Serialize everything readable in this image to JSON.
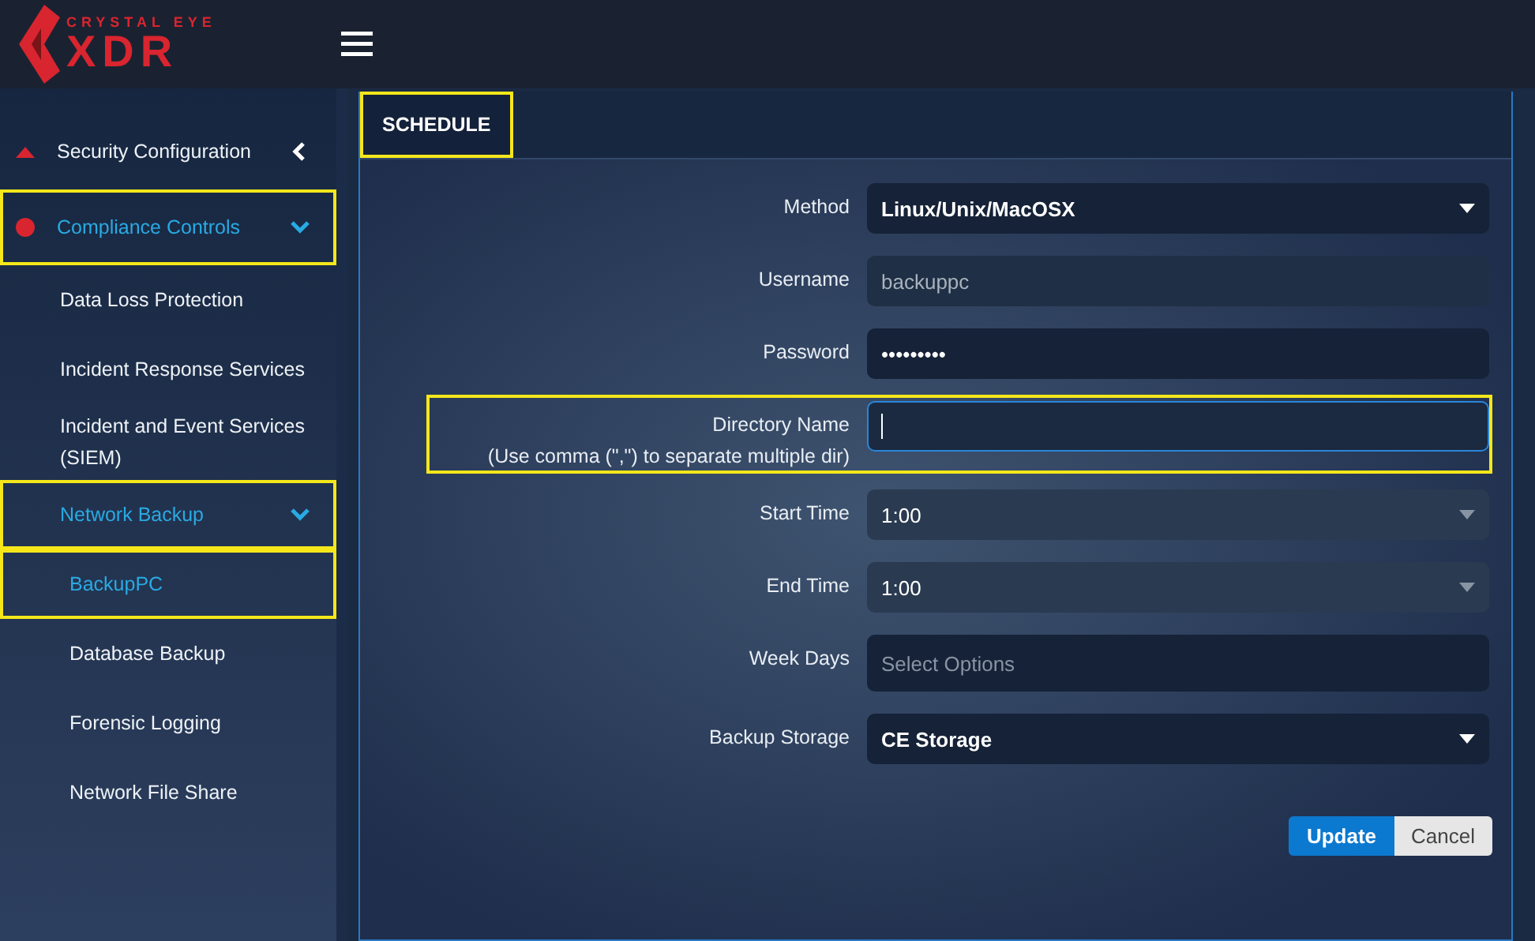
{
  "header": {
    "brand_top": "CRYSTAL EYE",
    "brand_main": "XDR"
  },
  "sidebar": {
    "items": [
      {
        "label": "Security Configuration",
        "kind": "section",
        "expanded": false,
        "selected": false,
        "highlighted": false
      },
      {
        "label": "Compliance Controls",
        "kind": "compliance",
        "expanded": true,
        "selected": true,
        "highlighted": true,
        "children": [
          {
            "label": "Data Loss Protection",
            "selected": false,
            "highlighted": false
          },
          {
            "label": "Incident Response Services",
            "selected": false,
            "highlighted": false
          },
          {
            "label": "Incident and Event Services (SIEM)",
            "selected": false,
            "highlighted": false
          },
          {
            "label": "Network Backup",
            "expanded": true,
            "selected": true,
            "highlighted": true,
            "children": [
              {
                "label": "BackupPC",
                "selected": true,
                "highlighted": true
              },
              {
                "label": "Database Backup",
                "selected": false,
                "highlighted": false
              },
              {
                "label": "Forensic Logging",
                "selected": false,
                "highlighted": false
              },
              {
                "label": "Network File Share",
                "selected": false,
                "highlighted": false
              }
            ]
          }
        ]
      }
    ]
  },
  "tabs": [
    {
      "label": "SCHEDULE",
      "selected": true,
      "highlighted": true
    }
  ],
  "form": {
    "fields": [
      {
        "kind": "select",
        "label": "Method",
        "value": "Linux/Unix/MacOSX",
        "bold": true,
        "highlighted": false
      },
      {
        "kind": "text",
        "label": "Username",
        "value": "backuppc",
        "disabled": true,
        "highlighted": false
      },
      {
        "kind": "text",
        "label": "Password",
        "value": "•••••••••",
        "disabled": false,
        "highlighted": false
      },
      {
        "kind": "text",
        "label": "Directory Name",
        "hint": "(Use comma (\",\") to separate multiple dir)",
        "focused": true,
        "disabled": false,
        "highlighted": true
      },
      {
        "kind": "select",
        "label": "Start Time",
        "value": "1:00",
        "bold": false,
        "highlighted": false
      },
      {
        "kind": "select",
        "label": "End Time",
        "value": "1:00",
        "bold": false,
        "highlighted": false
      },
      {
        "kind": "multiselect",
        "label": "Week Days",
        "placeholder": "Select Options",
        "highlighted": false
      },
      {
        "kind": "select",
        "label": "Backup Storage",
        "value": "CE Storage",
        "bold": true,
        "highlighted": false
      }
    ],
    "buttons": [
      {
        "kind": "primary",
        "label": "Update"
      },
      {
        "kind": "secondary",
        "label": "Cancel"
      }
    ]
  }
}
